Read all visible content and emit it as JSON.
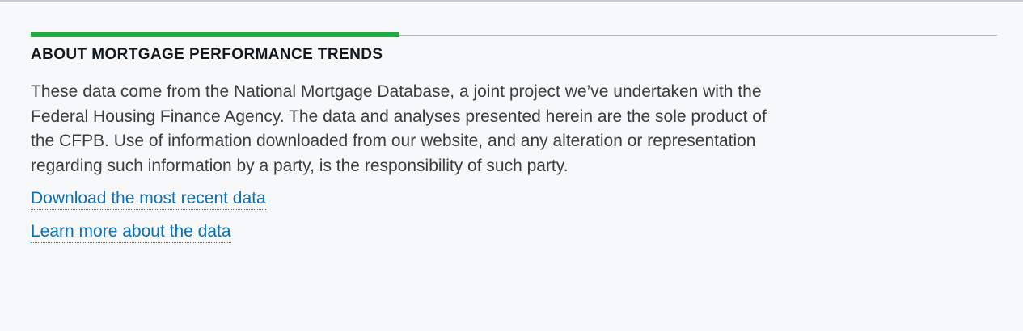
{
  "section": {
    "title": "ABOUT MORTGAGE PERFORMANCE TRENDS",
    "body": "These data come from the National Mortgage Database, a joint project we’ve undertaken with the Federal Housing Finance Agency. The data and analyses presented herein are the sole product of the CFPB. Use of information downloaded from our website, and any alteration or representation regarding such information by a party, is the responsibility of such party.",
    "links": [
      {
        "label": "Download the most recent data"
      },
      {
        "label": "Learn more about the data"
      }
    ]
  },
  "colors": {
    "accent_green": "#20aa3f",
    "link_blue": "#0a6fb5",
    "background": "#f7f8f9"
  }
}
